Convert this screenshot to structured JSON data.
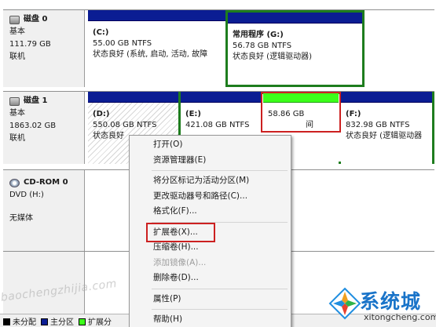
{
  "disks": [
    {
      "name": "磁盘 0",
      "type": "基本",
      "size": "111.79 GB",
      "status": "联机",
      "partitions": [
        {
          "label": "(C:)",
          "size": "55.00 GB NTFS",
          "status": "状态良好 (系统, 启动, 活动, 故障"
        },
        {
          "label": "常用程序 (G:)",
          "size": "56.78 GB NTFS",
          "status": "状态良好 (逻辑驱动器)"
        }
      ]
    },
    {
      "name": "磁盘 1",
      "type": "基本",
      "size": "1863.02 GB",
      "status": "联机",
      "partitions": [
        {
          "label": "(D:)",
          "size": "550.08 GB NTFS",
          "status": "状态良好"
        },
        {
          "label": "(E:)",
          "size": "421.08 GB NTFS",
          "status": ""
        },
        {
          "label": "",
          "size": "58.86 GB",
          "status": "间"
        },
        {
          "label": "(F:)",
          "size": "832.98 GB NTFS",
          "status": "状态良好 (逻辑驱动器"
        }
      ]
    },
    {
      "name": "CD-ROM 0",
      "type": "DVD (H:)",
      "size": "",
      "status": "无媒体",
      "partitions": []
    }
  ],
  "context_menu": {
    "items": [
      "打开(O)",
      "资源管理器(E)",
      "将分区标记为活动分区(M)",
      "更改驱动器号和路径(C)...",
      "格式化(F)...",
      "扩展卷(X)...",
      "压缩卷(H)...",
      "添加镜像(A)...",
      "删除卷(D)...",
      "属性(P)",
      "帮助(H)"
    ],
    "disabled": [
      "添加镜像(A)..."
    ],
    "highlighted": "扩展卷(X)..."
  },
  "legend": [
    {
      "label": "未分配",
      "color": "#000000"
    },
    {
      "label": "主分区",
      "color": "#0b1d93"
    },
    {
      "label": "扩展分",
      "color": "#3cff1a"
    }
  ],
  "watermark": "baochengzhijia.com",
  "brand": {
    "name": "系统城",
    "url": "xitongcheng.com"
  },
  "colors": {
    "primary_partition": "#0b1d93",
    "free_space": "#3cff1a",
    "logical_frame": "#1e7d1e",
    "highlight": "#cc2020"
  }
}
